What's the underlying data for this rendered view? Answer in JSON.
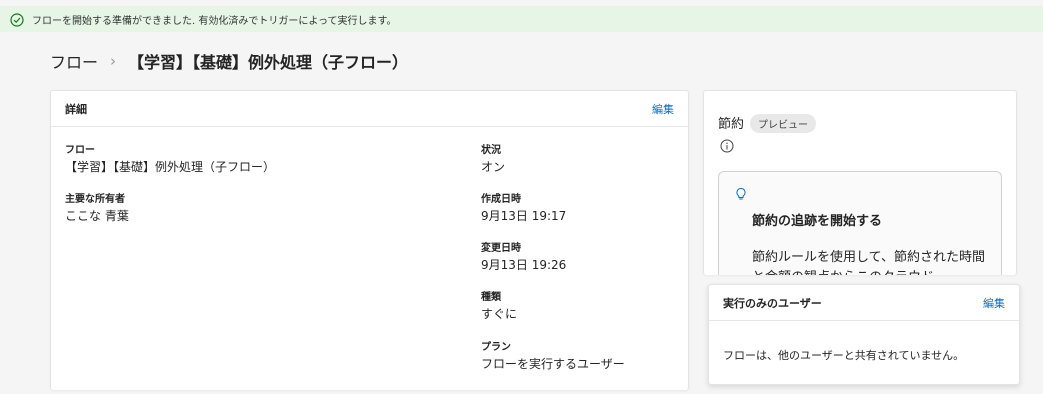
{
  "banner": {
    "message": "フローを開始する準備ができました. 有効化済みでトリガーによって実行します。",
    "icon": "checkmark-circle-icon",
    "color": "#e6f5e6"
  },
  "breadcrumb": {
    "root": "フロー",
    "separator": "›",
    "current": "【学習】【基礎】例外処理（子フロー）"
  },
  "details": {
    "title": "詳細",
    "edit_label": "編集",
    "left_fields": [
      {
        "label": "フロー",
        "value": "【学習】【基礎】例外処理（子フロー）"
      },
      {
        "label": "主要な所有者",
        "value": "ここな 青葉"
      }
    ],
    "right_fields": [
      {
        "label": "状況",
        "value": "オン"
      },
      {
        "label": "作成日時",
        "value": "9月13日 19:17"
      },
      {
        "label": "変更日時",
        "value": "9月13日 19:26"
      },
      {
        "label": "種類",
        "value": "すぐに"
      },
      {
        "label": "プラン",
        "value": "フローを実行するユーザー"
      }
    ]
  },
  "savings": {
    "title": "節約",
    "badge": "プレビュー",
    "inner_title": "節約の追跡を開始する",
    "inner_body": "節約ルールを使用して、節約された時間と金額の観点からこのクラウド"
  },
  "run_only": {
    "title": "実行のみのユーザー",
    "edit_label": "編集",
    "message": "フローは、他のユーザーと共有されていません。"
  },
  "colors": {
    "accent": "#0f6cbd",
    "success": "#107c10"
  }
}
